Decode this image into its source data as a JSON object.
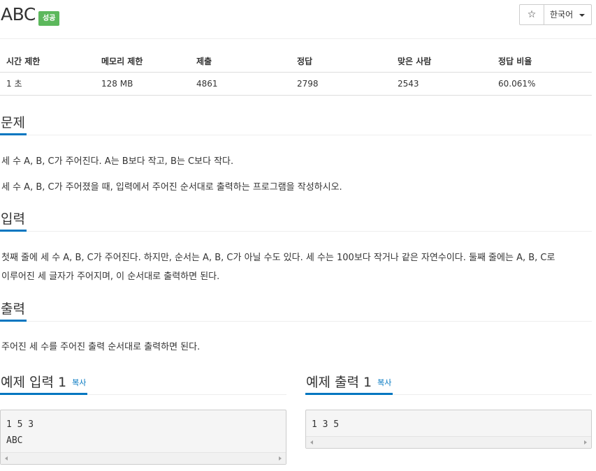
{
  "problem": {
    "title": "ABC",
    "status_badge": "성공"
  },
  "toolbar": {
    "star_label": "☆",
    "language_label": "한국어"
  },
  "info_table": {
    "headers": [
      "시간 제한",
      "메모리 제한",
      "제출",
      "정답",
      "맞은 사람",
      "정답 비율"
    ],
    "row": [
      "1 초",
      "128 MB",
      "4861",
      "2798",
      "2543",
      "60.061%"
    ]
  },
  "sections": {
    "problem": {
      "heading": "문제",
      "lines": [
        "세 수 A, B, C가 주어진다. A는 B보다 작고, B는 C보다 작다.",
        "세 수 A, B, C가 주어졌을 때, 입력에서 주어진 순서대로 출력하는 프로그램을 작성하시오."
      ]
    },
    "input": {
      "heading": "입력",
      "lines": [
        "첫째 줄에 세 수 A, B, C가 주어진다. 하지만, 순서는 A, B, C가 아닐 수도 있다. 세 수는 100보다 작거나 같은 자연수이다. 둘째 줄에는 A, B, C로",
        "이루어진 세 글자가 주어지며, 이 순서대로 출력하면 된다."
      ]
    },
    "output": {
      "heading": "출력",
      "lines": [
        "주어진 세 수를 주어진 출력 순서대로 출력하면 된다."
      ]
    }
  },
  "samples": {
    "input": {
      "heading": "예제 입력 1",
      "copy_label": "복사",
      "lines": [
        "1 5 3",
        "ABC"
      ]
    },
    "output": {
      "heading": "예제 출력 1",
      "copy_label": "복사",
      "lines": [
        "1 3 5"
      ]
    }
  },
  "colors": {
    "accent": "#0076c0",
    "success": "#5cb85c"
  }
}
